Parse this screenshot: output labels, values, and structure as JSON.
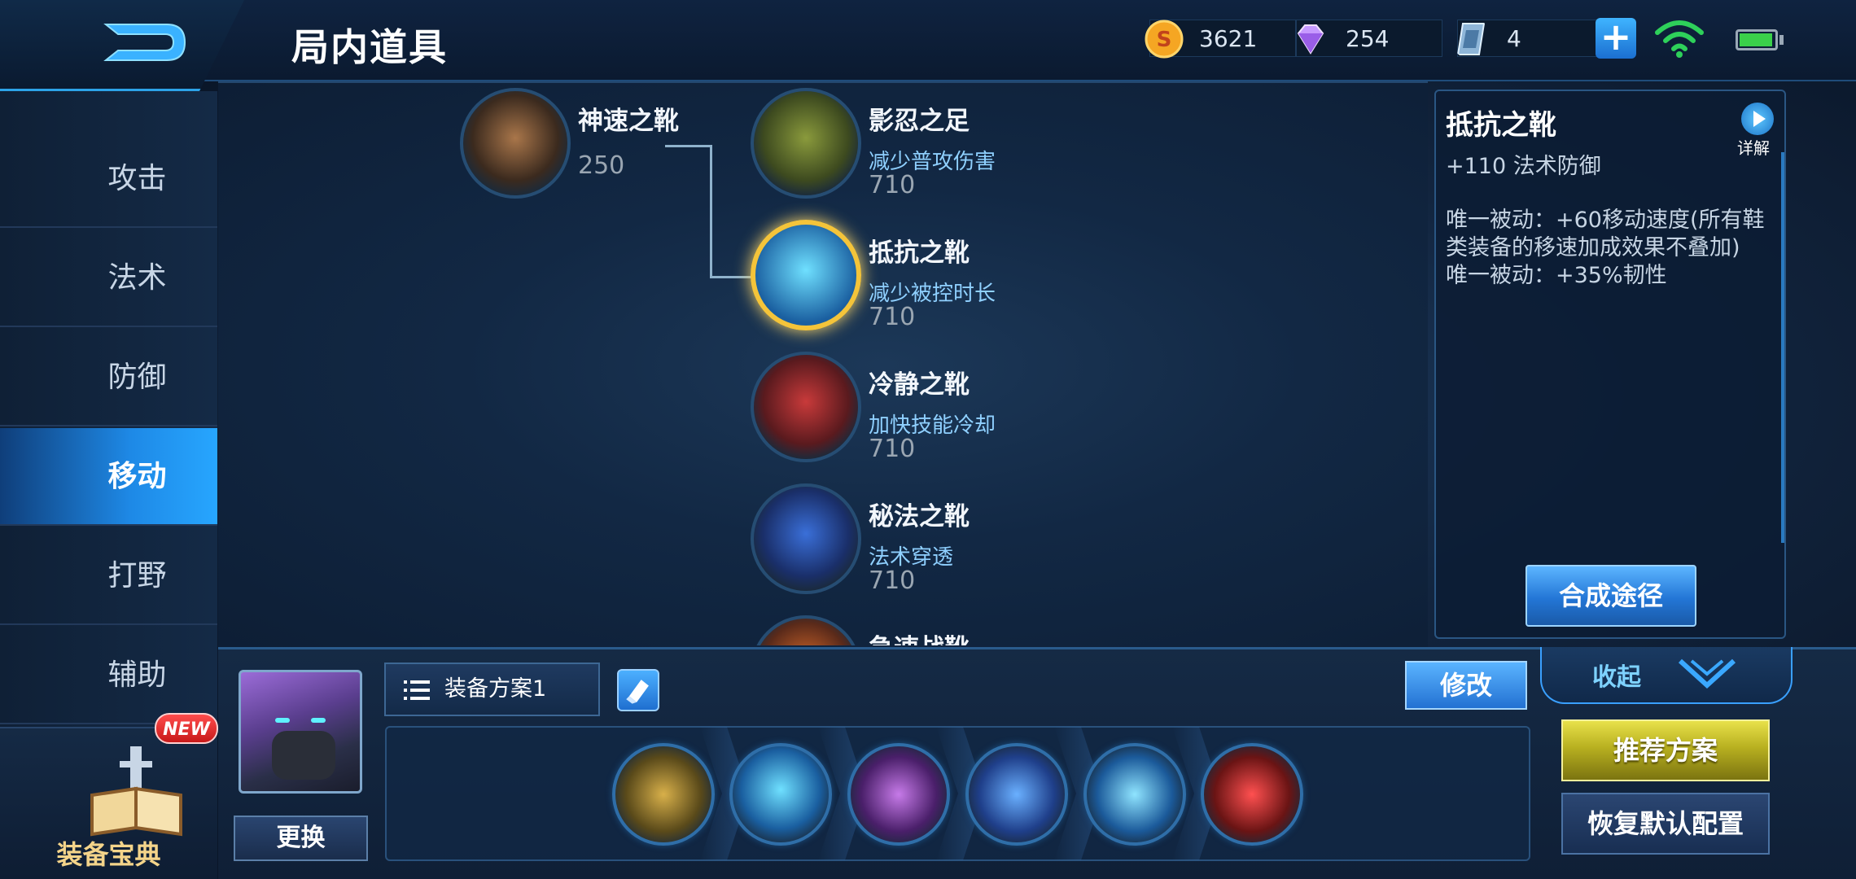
{
  "header": {
    "title": "局内道具",
    "currencies": [
      {
        "icon": "gold-coin-icon",
        "value": "3621"
      },
      {
        "icon": "diamond-icon",
        "value": "254"
      },
      {
        "icon": "voucher-card-icon",
        "value": "4"
      }
    ]
  },
  "nav": {
    "items": [
      {
        "label": "攻击"
      },
      {
        "label": "法术"
      },
      {
        "label": "防御"
      },
      {
        "label": "移动",
        "active": true
      },
      {
        "label": "打野"
      },
      {
        "label": "辅助"
      }
    ],
    "codex_label": "装备宝典",
    "new_badge": "NEW"
  },
  "items": [
    {
      "name": "神速之靴",
      "price": "250"
    },
    {
      "name": "影忍之足",
      "desc": "减少普攻伤害",
      "price": "710"
    },
    {
      "name": "抵抗之靴",
      "desc": "减少被控时长",
      "price": "710",
      "selected": true
    },
    {
      "name": "冷静之靴",
      "desc": "加快技能冷却",
      "price": "710"
    },
    {
      "name": "秘法之靴",
      "desc": "法术穿透",
      "price": "710"
    },
    {
      "name": "急速战靴"
    }
  ],
  "info": {
    "title": "抵抗之靴",
    "detail_label": "详解",
    "stat": "+110 法术防御",
    "passive": "唯一被动：+60移动速度(所有鞋类装备的移速加成效果不叠加)\n唯一被动：+35%韧性",
    "compose_label": "合成途径"
  },
  "bottom": {
    "change_label": "更换",
    "plan_label": "装备方案1",
    "modify_label": "修改",
    "collapse_label": "收起",
    "recommend_label": "推荐方案",
    "reset_label": "恢复默认配置"
  },
  "colors": {
    "accent": "#27a6ff",
    "selected_ring": "#f4c43a",
    "desc_text": "#8fd0ff",
    "recommend_btn": "#b8b020"
  }
}
